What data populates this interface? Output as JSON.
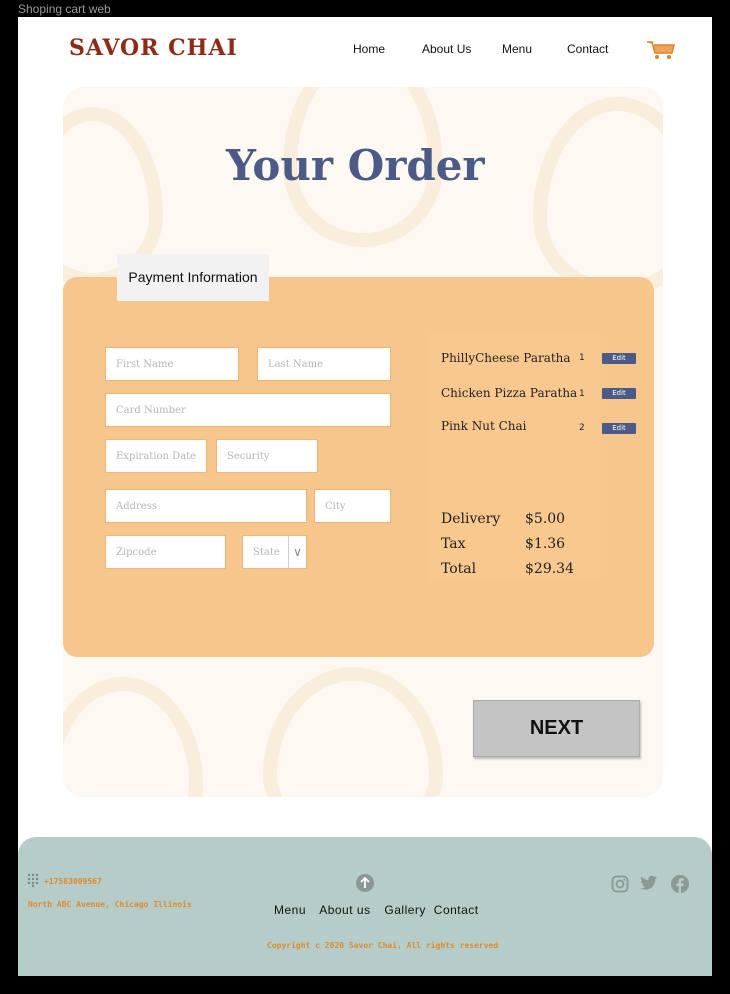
{
  "window": {
    "title": "Shoping cart web"
  },
  "header": {
    "logo": "SAVOR CHAI",
    "nav": [
      "Home",
      "About Us",
      "Menu",
      "Contact"
    ]
  },
  "page": {
    "title": "Your Order"
  },
  "payment": {
    "tab_label": "Payment Information",
    "fields": {
      "first_name": "First Name",
      "last_name": "Last Name",
      "card_number": "Card Number",
      "expiration": "Expiration Date",
      "security": "Security",
      "address": "Address",
      "city": "City",
      "zipcode": "Zipcode",
      "state": "State"
    }
  },
  "order": {
    "items": [
      {
        "name": "PhillyCheese Paratha",
        "qty": "1",
        "edit": "Edit"
      },
      {
        "name": "Chicken Pizza Paratha",
        "qty": "1",
        "edit": "Edit"
      },
      {
        "name": "Pink Nut Chai",
        "qty": "2",
        "edit": "Edit"
      }
    ],
    "delivery_label": "Delivery",
    "delivery": "$5.00",
    "tax_label": "Tax",
    "tax": "$1.36",
    "total_label": "Total",
    "total": "$29.34"
  },
  "next_button": "NEXT",
  "footer": {
    "phone": "+17583009567",
    "address": "North ABC Avenue, Chicago Illinois",
    "links": [
      "Menu",
      "About us",
      "Gallery",
      "Contact"
    ],
    "copyright": "Copyright c 2020 Savor Chai, All rights reserved"
  },
  "colors": {
    "accent": "#4b5a86",
    "panel": "#f7c68c",
    "footer": "#b5ccc8",
    "brand": "#8e2a16"
  },
  "icons": [
    "cart-icon",
    "dialpad-icon",
    "arrow-up-icon",
    "instagram-icon",
    "twitter-icon",
    "facebook-icon"
  ]
}
